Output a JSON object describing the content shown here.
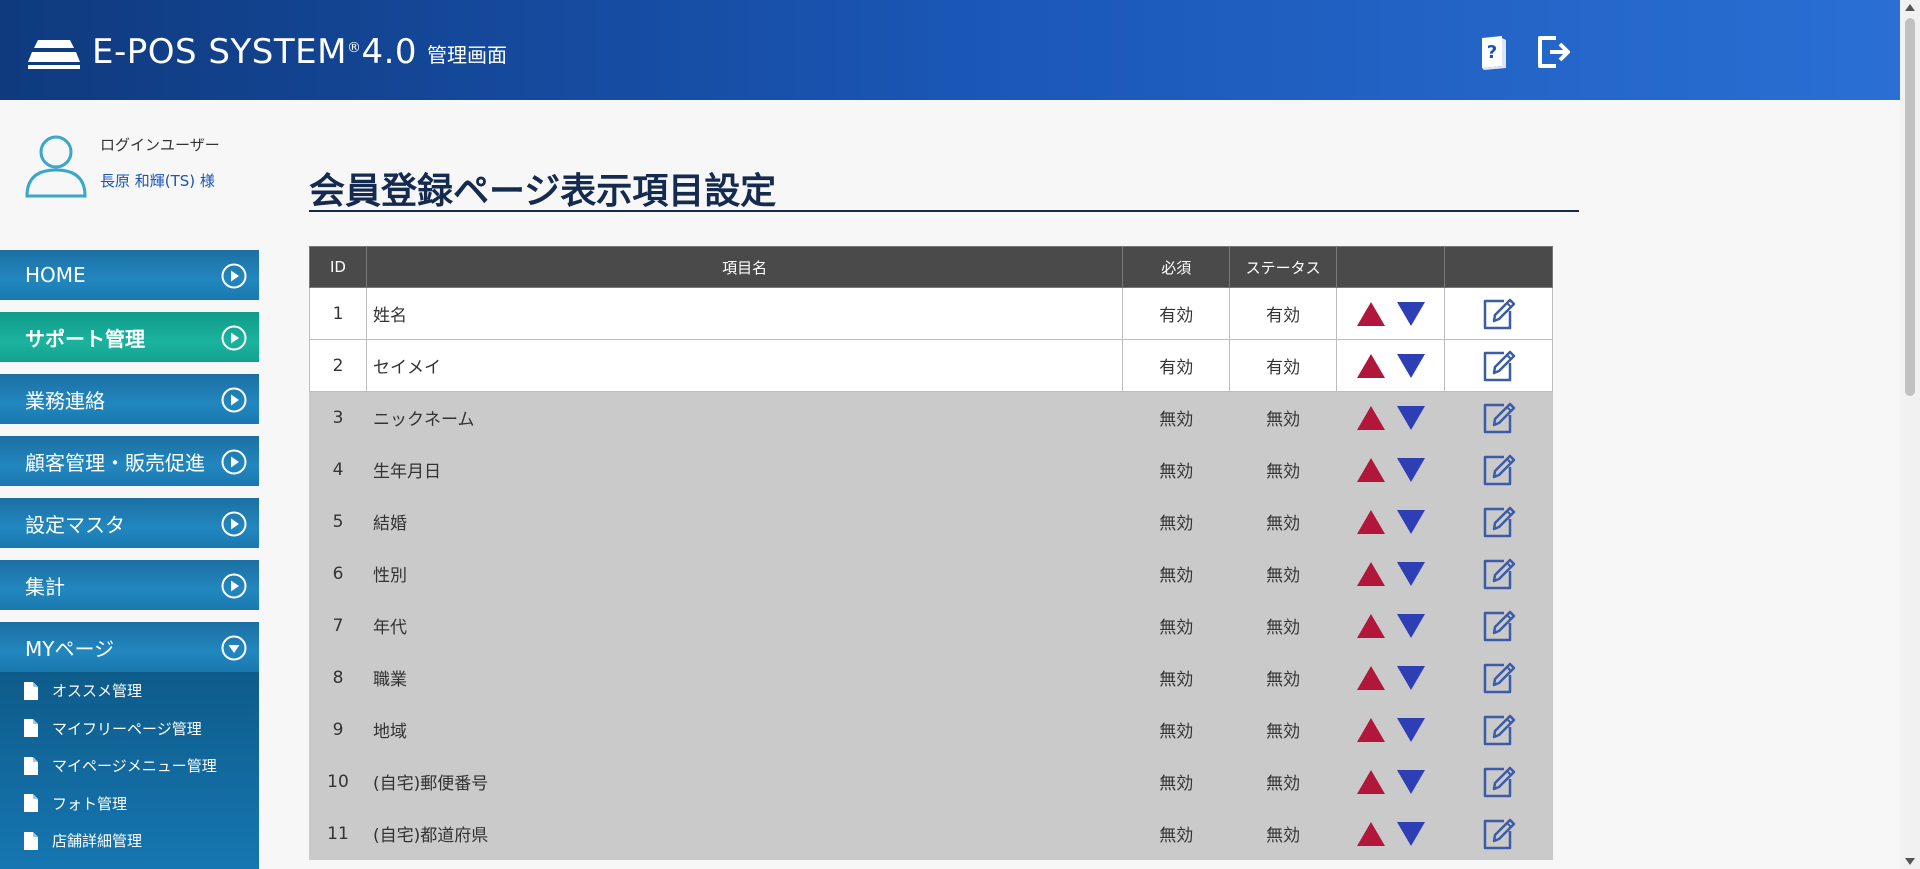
{
  "header": {
    "logo_text": "E-POS SYSTEM",
    "logo_reg": "®",
    "logo_version": "4.0",
    "logo_sub": "管理画面",
    "manual_icon": "manual-book-icon",
    "logout_icon": "logout-icon",
    "accent": "#1a56b5"
  },
  "user": {
    "label": "ログインユーザー",
    "name": "長原 和輝(TS) 様"
  },
  "sidebar": {
    "items": [
      {
        "label": "HOME"
      },
      {
        "label": "サポート管理"
      },
      {
        "label": "業務連絡"
      },
      {
        "label": "顧客管理・販売促進"
      },
      {
        "label": "設定マスタ"
      },
      {
        "label": "集計"
      },
      {
        "label": "MYページ"
      }
    ],
    "submenu": [
      {
        "label": "オススメ管理"
      },
      {
        "label": "マイフリーページ管理"
      },
      {
        "label": "マイページメニュー管理"
      },
      {
        "label": "フォト管理"
      },
      {
        "label": "店舗詳細管理"
      }
    ]
  },
  "main": {
    "title": "会員登録ページ表示項目設定",
    "table": {
      "headers": [
        "ID",
        "項目名",
        "必須",
        "ステータス",
        "",
        ""
      ],
      "rows": [
        {
          "id": "1",
          "name": "姓名",
          "required": "有効",
          "status": "有効"
        },
        {
          "id": "2",
          "name": "セイメイ",
          "required": "有効",
          "status": "有効"
        },
        {
          "id": "3",
          "name": "ニックネーム",
          "required": "無効",
          "status": "無効"
        },
        {
          "id": "4",
          "name": "生年月日",
          "required": "無効",
          "status": "無効"
        },
        {
          "id": "5",
          "name": "結婚",
          "required": "無効",
          "status": "無効"
        },
        {
          "id": "6",
          "name": "性別",
          "required": "無効",
          "status": "無効"
        },
        {
          "id": "7",
          "name": "年代",
          "required": "無効",
          "status": "無効"
        },
        {
          "id": "8",
          "name": "職業",
          "required": "無効",
          "status": "無効"
        },
        {
          "id": "9",
          "name": "地域",
          "required": "無効",
          "status": "無効"
        },
        {
          "id": "10",
          "name": "(自宅)郵便番号",
          "required": "無効",
          "status": "無効"
        },
        {
          "id": "11",
          "name": "(自宅)都道府県",
          "required": "無効",
          "status": "無効"
        }
      ]
    },
    "colors": {
      "up_arrow": "#b0173a",
      "down_arrow": "#2e3fb5",
      "edit_icon": "#3c5ca8",
      "title": "#152a4f"
    }
  }
}
